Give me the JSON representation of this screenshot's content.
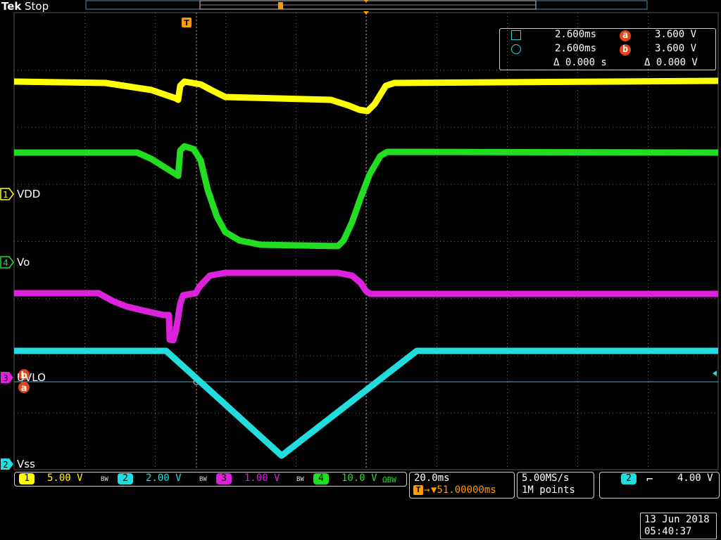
{
  "header": {
    "brand": "Tek",
    "run_state": "Stop"
  },
  "cursor_readout": {
    "row1_time": "2.600ms",
    "row1_value": "3.600 V",
    "row1_badge": "a",
    "row2_time": "2.600ms",
    "row2_value": "3.600 V",
    "row2_badge": "b",
    "delta_time": "Δ 0.000 s",
    "delta_value": "Δ 0.000 V"
  },
  "channel_labels": {
    "ch1": {
      "number": "1",
      "name": "VDD",
      "color": "#ffff00"
    },
    "ch4": {
      "number": "4",
      "name": "Vo",
      "color": "#22dd22"
    },
    "ch3": {
      "number": "3",
      "name": "UVLO",
      "color": "#dd22dd"
    },
    "ch2": {
      "number": "2",
      "name": "Vss",
      "color": "#22dddd"
    }
  },
  "trigger_marker": "T",
  "cursor_markers": {
    "a": "a",
    "b": "b"
  },
  "vertical_settings": [
    {
      "number": "1",
      "scale": "5.00 V",
      "color": "#ffff00",
      "bw": "BW"
    },
    {
      "number": "2",
      "scale": "2.00 V",
      "color": "#22dddd",
      "bw": "BW"
    },
    {
      "number": "3",
      "scale": "1.00 V",
      "color": "#dd22dd",
      "bw": "BW"
    },
    {
      "number": "4",
      "scale": "10.0 V",
      "color": "#22dd22",
      "bw": "ΩBW"
    }
  ],
  "horizontal": {
    "timebase": "20.0ms",
    "trigger_position": "▼51.00000ms",
    "trigger_prefix": "T→"
  },
  "acquisition": {
    "sample_rate": "5.00MS/s",
    "record_length": "1M points"
  },
  "trigger": {
    "source": "2",
    "slope": "falling",
    "slope_glyph": "˥",
    "level": "4.00 V"
  },
  "timestamp": {
    "date": "13 Jun 2018",
    "time": "05:40:37"
  },
  "colors": {
    "ch1": "#ffff00",
    "ch2": "#22dddd",
    "ch3": "#dd22dd",
    "ch4": "#22dd22",
    "trigger": "#ff9900",
    "cursor_badge": "#e0461a",
    "grid": "#5a5a5a"
  }
}
